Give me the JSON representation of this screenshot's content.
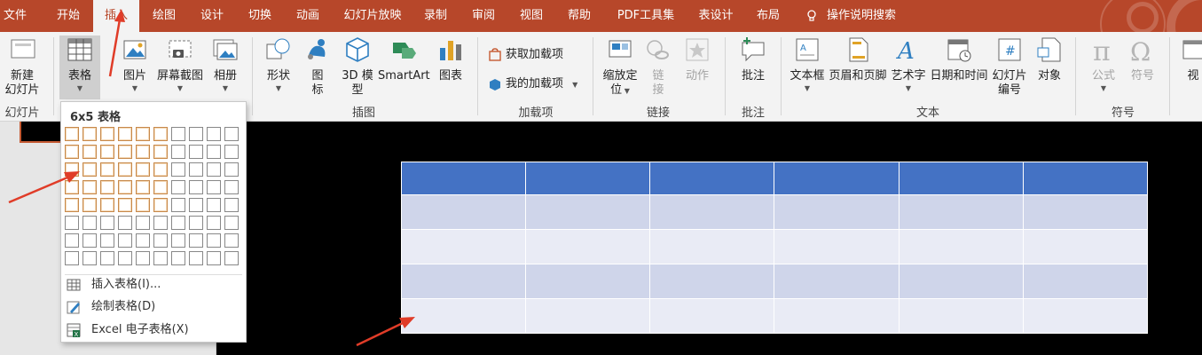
{
  "tabs": [
    "文件",
    "开始",
    "插入",
    "绘图",
    "设计",
    "切换",
    "动画",
    "幻灯片放映",
    "录制",
    "审阅",
    "视图",
    "帮助",
    "PDF工具集",
    "表设计",
    "布局"
  ],
  "active_tab": "插入",
  "search": "操作说明搜索",
  "ribbon": {
    "new_slide": {
      "line1": "新建",
      "line2": "幻灯片"
    },
    "table": "表格",
    "picture": "图片",
    "screenshot": "屏幕截图",
    "album": "相册",
    "shapes": "形状",
    "icons": {
      "line1": "图",
      "line2": "标"
    },
    "model3d": {
      "line1": "3D 模",
      "line2": "型"
    },
    "smartart": "SmartArt",
    "chart": "图表",
    "get_addins": "获取加载项",
    "my_addins": "我的加载项",
    "zoom": {
      "line1": "缩放定",
      "line2": "位"
    },
    "link": {
      "line1": "链",
      "line2": "接"
    },
    "action": "动作",
    "comment": "批注",
    "textbox": "文本框",
    "header_footer": "页眉和页脚",
    "wordart": "艺术字",
    "datetime": "日期和时间",
    "slide_number": {
      "line1": "幻灯片",
      "line2": "编号"
    },
    "object": "对象",
    "equation": "公式",
    "symbol": "符号",
    "video": "视"
  },
  "groups": {
    "slides": "幻灯片",
    "images": "插图",
    "addins": "加载项",
    "links": "链接",
    "comments": "批注",
    "text": "文本",
    "symbols": "符号"
  },
  "dropdown": {
    "title": "6x5 表格",
    "grid_cols": 10,
    "grid_rows": 8,
    "selected_cols": 6,
    "selected_rows": 5,
    "items": [
      "插入表格(I)...",
      "绘制表格(D)",
      "Excel 电子表格(X)"
    ]
  },
  "preview_table": {
    "cols": 6,
    "rows": 5
  },
  "colors": {
    "accent": "#b7472a",
    "table_header": "#4472c4",
    "table_band": "#cfd5ea",
    "highlight": "#c7894b",
    "arrow": "#e03c28"
  }
}
